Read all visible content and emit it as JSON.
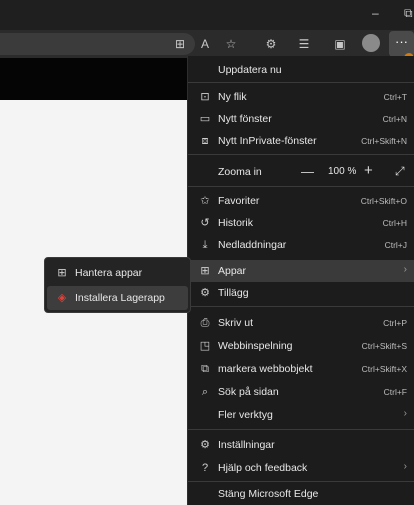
{
  "window": {
    "minimize": "–",
    "restore": "⧉"
  },
  "toolbar": {
    "icons": [
      "split-screen-icon",
      "read-aloud-icon",
      "favorite-star-icon",
      "extensions-icon",
      "favorites-bar-icon",
      "collections-icon",
      "profile-icon",
      "more-icon"
    ],
    "more_label": "···"
  },
  "menu": {
    "update": "Uppdatera nu",
    "new_tab": {
      "label": "Ny flik",
      "shortcut": "Ctrl+T"
    },
    "new_window": {
      "label": "Nytt fönster",
      "shortcut": "Ctrl+N"
    },
    "new_private": {
      "label": "Nytt InPrivate-fönster",
      "shortcut": "Ctrl+Skift+N"
    },
    "zoom": {
      "label": "Zooma in",
      "minus": "—",
      "value": "100 %",
      "plus": "+",
      "fullscreen": "⤢"
    },
    "favorites": {
      "label": "Favoriter",
      "shortcut": "Ctrl+Skift+O"
    },
    "history": {
      "label": "Historik",
      "shortcut": "Ctrl+H"
    },
    "downloads": {
      "label": "Nedladdningar",
      "shortcut": "Ctrl+J"
    },
    "apps": {
      "label": "Appar",
      "chevron": "›"
    },
    "extensions": {
      "label": "Tillägg"
    },
    "print": {
      "label": "Skriv ut",
      "shortcut": "Ctrl+P"
    },
    "web_capture": {
      "label": "Webbinspelning",
      "shortcut": "Ctrl+Skift+S"
    },
    "web_select": {
      "label": "markera webbobjekt",
      "shortcut": "Ctrl+Skift+X"
    },
    "find": {
      "label": "Sök på sidan",
      "shortcut": "Ctrl+F"
    },
    "more_tools": {
      "label": "Fler verktyg",
      "chevron": "›"
    },
    "settings": {
      "label": "Inställningar"
    },
    "help": {
      "label": "Hjälp och feedback",
      "chevron": "›"
    },
    "close": {
      "label": "Stäng Microsoft Edge"
    }
  },
  "submenu": {
    "manage": "Hantera appar",
    "install": "Installera Lagerapp"
  }
}
